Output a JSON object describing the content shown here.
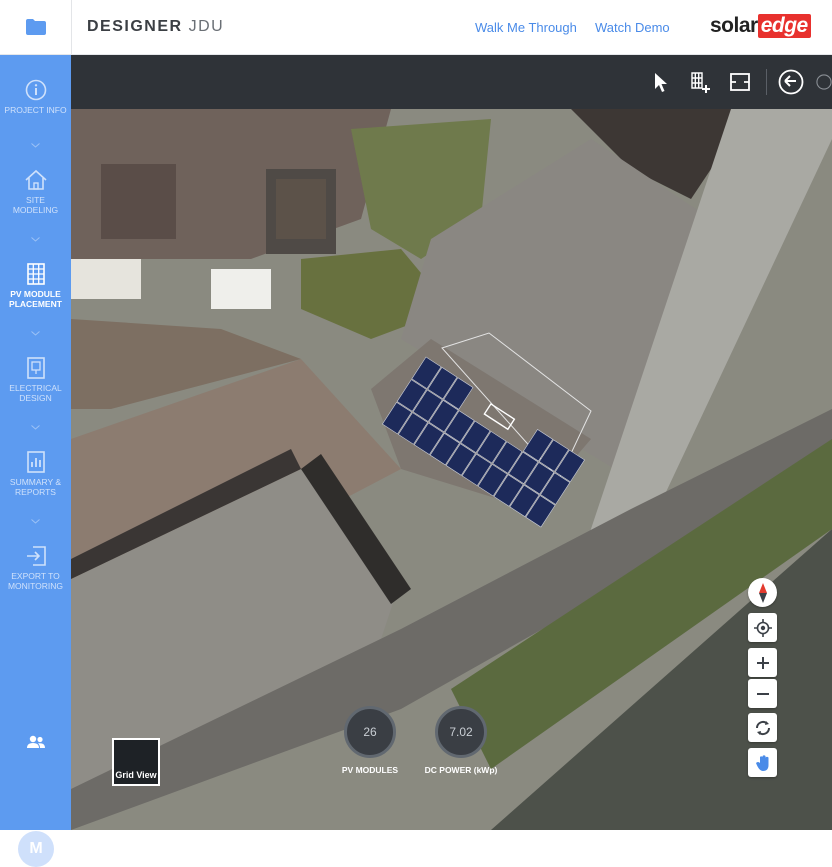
{
  "header": {
    "app_name": "DESIGNER",
    "project_name": "JDU",
    "links": [
      "Walk Me Through",
      "Watch Demo"
    ],
    "logo_solar": "solar",
    "logo_edge": "edge"
  },
  "sidebar": {
    "items": [
      {
        "label": "PROJECT INFO",
        "icon": "info-icon"
      },
      {
        "label": "SITE MODELING",
        "icon": "home-icon"
      },
      {
        "label": "PV MODULE PLACEMENT",
        "icon": "grid-icon",
        "active": true
      },
      {
        "label": "ELECTRICAL DESIGN",
        "icon": "electrical-icon"
      },
      {
        "label": "SUMMARY & REPORTS",
        "icon": "report-icon"
      },
      {
        "label": "EXPORT TO MONITORING",
        "icon": "export-icon"
      }
    ],
    "avatar_initial": "M"
  },
  "map": {
    "grid_view_label": "Grid View",
    "stats": [
      {
        "value": "26",
        "label": "PV MODULES"
      },
      {
        "value": "7.02",
        "label": "DC POWER (kWp)"
      }
    ]
  },
  "colors": {
    "sidebar": "#5d9bf0",
    "toolbar": "#2f3338",
    "accent_link": "#4a8be8",
    "logo_red": "#e8312e"
  }
}
